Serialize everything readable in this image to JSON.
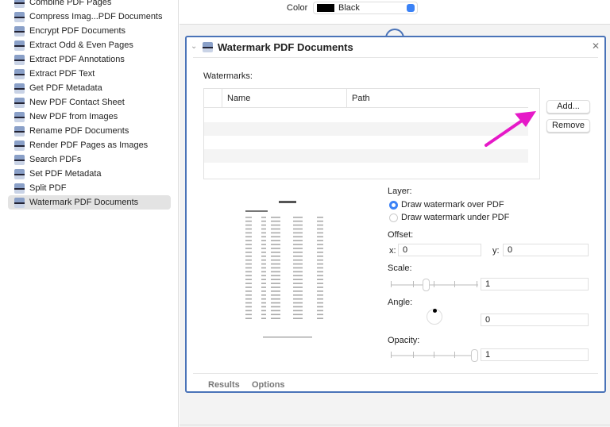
{
  "sidebar": {
    "items": [
      "Combine PDF Pages",
      "Compress Imag...PDF Documents",
      "Encrypt PDF Documents",
      "Extract Odd & Even Pages",
      "Extract PDF Annotations",
      "Extract PDF Text",
      "Get PDF Metadata",
      "New PDF Contact Sheet",
      "New PDF from Images",
      "Rename PDF Documents",
      "Render PDF Pages as Images",
      "Search PDFs",
      "Set PDF Metadata",
      "Split PDF",
      "Watermark PDF Documents"
    ],
    "selected": "Watermark PDF Documents"
  },
  "topbar": {
    "color_label": "Color",
    "color_value": "Black",
    "color_swatch": "#000000"
  },
  "panel": {
    "title": "Watermark PDF Documents",
    "watermarks_label": "Watermarks:",
    "columns": [
      "Name",
      "Path"
    ],
    "add_button": "Add...",
    "remove_button": "Remove",
    "layer_label": "Layer:",
    "layer_options": [
      "Draw watermark over PDF",
      "Draw watermark under PDF"
    ],
    "layer_selected": "Draw watermark over PDF",
    "offset_label": "Offset:",
    "x_label": "x:",
    "x_value": "0",
    "y_label": "y:",
    "y_value": "0",
    "scale_label": "Scale:",
    "scale_value": "1",
    "scale_slider_fraction": 0.4,
    "angle_label": "Angle:",
    "angle_value": "0",
    "opacity_label": "Opacity:",
    "opacity_value": "1",
    "opacity_slider_fraction": 1.0,
    "footer_tabs": [
      "Results",
      "Options"
    ]
  },
  "colors": {
    "accent": "#3b82f6",
    "panel_border": "#4a73b8",
    "annotation_arrow": "#e619c8"
  }
}
